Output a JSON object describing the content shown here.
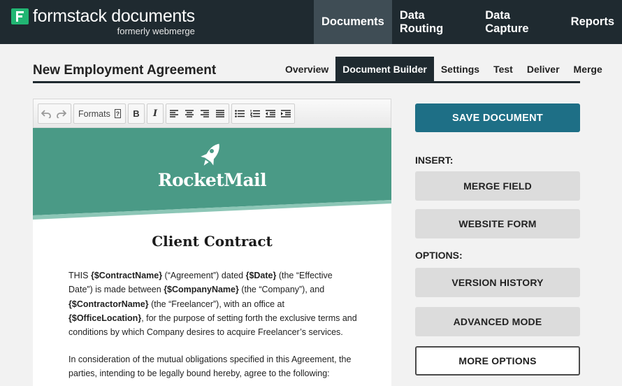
{
  "app": {
    "logo_title": "formstack documents",
    "logo_subtitle": "formerly webmerge",
    "brand_color": "#21b573"
  },
  "nav": {
    "items": [
      {
        "label": "Documents",
        "active": true
      },
      {
        "label": "Data Routing",
        "active": false
      },
      {
        "label": "Data Capture",
        "active": false
      },
      {
        "label": "Reports",
        "active": false
      }
    ]
  },
  "page": {
    "title": "New Employment Agreement"
  },
  "tabs": [
    {
      "label": "Overview",
      "active": false
    },
    {
      "label": "Document Builder",
      "active": true
    },
    {
      "label": "Settings",
      "active": false
    },
    {
      "label": "Test",
      "active": false
    },
    {
      "label": "Deliver",
      "active": false
    },
    {
      "label": "Merge",
      "active": false
    }
  ],
  "toolbar": {
    "formats_label": "Formats",
    "help_glyph": "?",
    "bold_glyph": "B",
    "italic_glyph": "I"
  },
  "document": {
    "banner_color": "#4a9a86",
    "brand_name": "RocketMail",
    "title": "Client Contract",
    "paragraph1": [
      {
        "t": "THIS ",
        "b": false
      },
      {
        "t": "{$ContractName}",
        "b": true
      },
      {
        "t": " (“Agreement”) dated ",
        "b": false
      },
      {
        "t": "{$Date}",
        "b": true
      },
      {
        "t": " (the “Effective Date”) is made between ",
        "b": false
      },
      {
        "t": "{$CompanyName}",
        "b": true
      },
      {
        "t": " (the “Company”), and ",
        "b": false
      },
      {
        "t": "{$ContractorName}",
        "b": true
      },
      {
        "t": " (the “Freelancer”), with an office at ",
        "b": false
      },
      {
        "t": "{$OfficeLocation}",
        "b": true
      },
      {
        "t": ", for the purpose of setting forth the exclusive terms and conditions by which Company desires to acquire Freelancer’s services.",
        "b": false
      }
    ],
    "paragraph2": "In consideration of the mutual obligations specified in this Agreement, the parties, intending to be legally bound hereby, agree to the following:"
  },
  "sidebar": {
    "save_label": "SAVE DOCUMENT",
    "save_color": "#1e6f86",
    "insert_label": "INSERT:",
    "merge_field_label": "MERGE FIELD",
    "website_form_label": "WEBSITE FORM",
    "options_label": "OPTIONS:",
    "version_history_label": "VERSION HISTORY",
    "advanced_mode_label": "ADVANCED MODE",
    "more_options_label": "MORE OPTIONS"
  }
}
